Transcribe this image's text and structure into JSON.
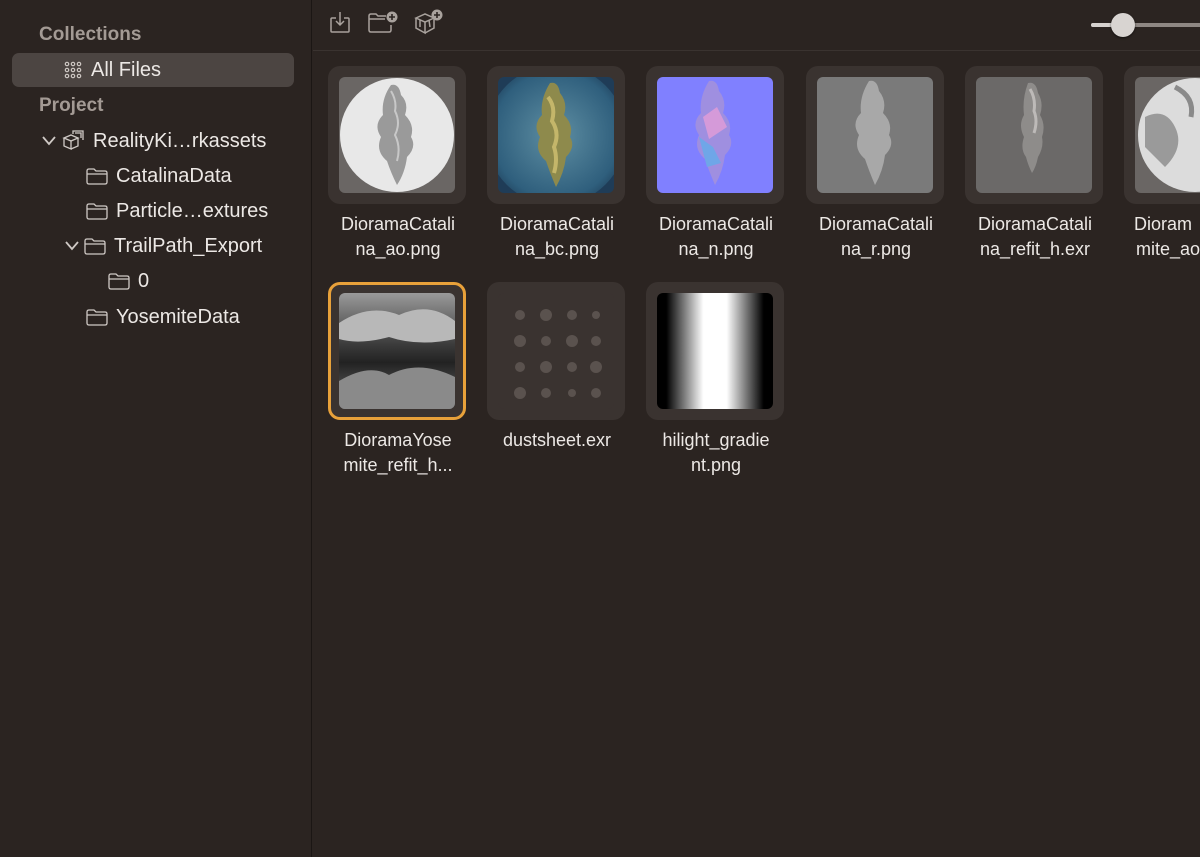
{
  "sidebar": {
    "collections_heading": "Collections",
    "all_files": "All Files",
    "project_heading": "Project",
    "tree": {
      "root": "RealityKi…rkassets",
      "catalina": "CatalinaData",
      "particle": "Particle…extures",
      "trailpath": "TrailPath_Export",
      "zero": "0",
      "yosemite": "YosemiteData"
    }
  },
  "toolbar": {
    "import_icon": "import-icon",
    "new_folder_icon": "new-folder-icon",
    "new_entity_icon": "add-3d-object-icon",
    "zoom_level": 0.27
  },
  "files": [
    {
      "line1": "DioramaCatali",
      "line2": "na_ao.png"
    },
    {
      "line1": "DioramaCatali",
      "line2": "na_bc.png"
    },
    {
      "line1": "DioramaCatali",
      "line2": "na_n.png"
    },
    {
      "line1": "DioramaCatali",
      "line2": "na_r.png"
    },
    {
      "line1": "DioramaCatali",
      "line2": "na_refit_h.exr"
    },
    {
      "line1": "Dioram",
      "line2": "mite_ao"
    },
    {
      "line1": "DioramaYose",
      "line2": "mite_refit_h..."
    },
    {
      "line1": "dustsheet.exr",
      "line2": ""
    },
    {
      "line1": "hilight_gradie",
      "line2": "nt.png"
    }
  ],
  "colors": {
    "background": "#2b2421",
    "selection_row": "#4c4542",
    "tile_bg": "#3a3330",
    "selection_accent": "#e8a13a"
  }
}
